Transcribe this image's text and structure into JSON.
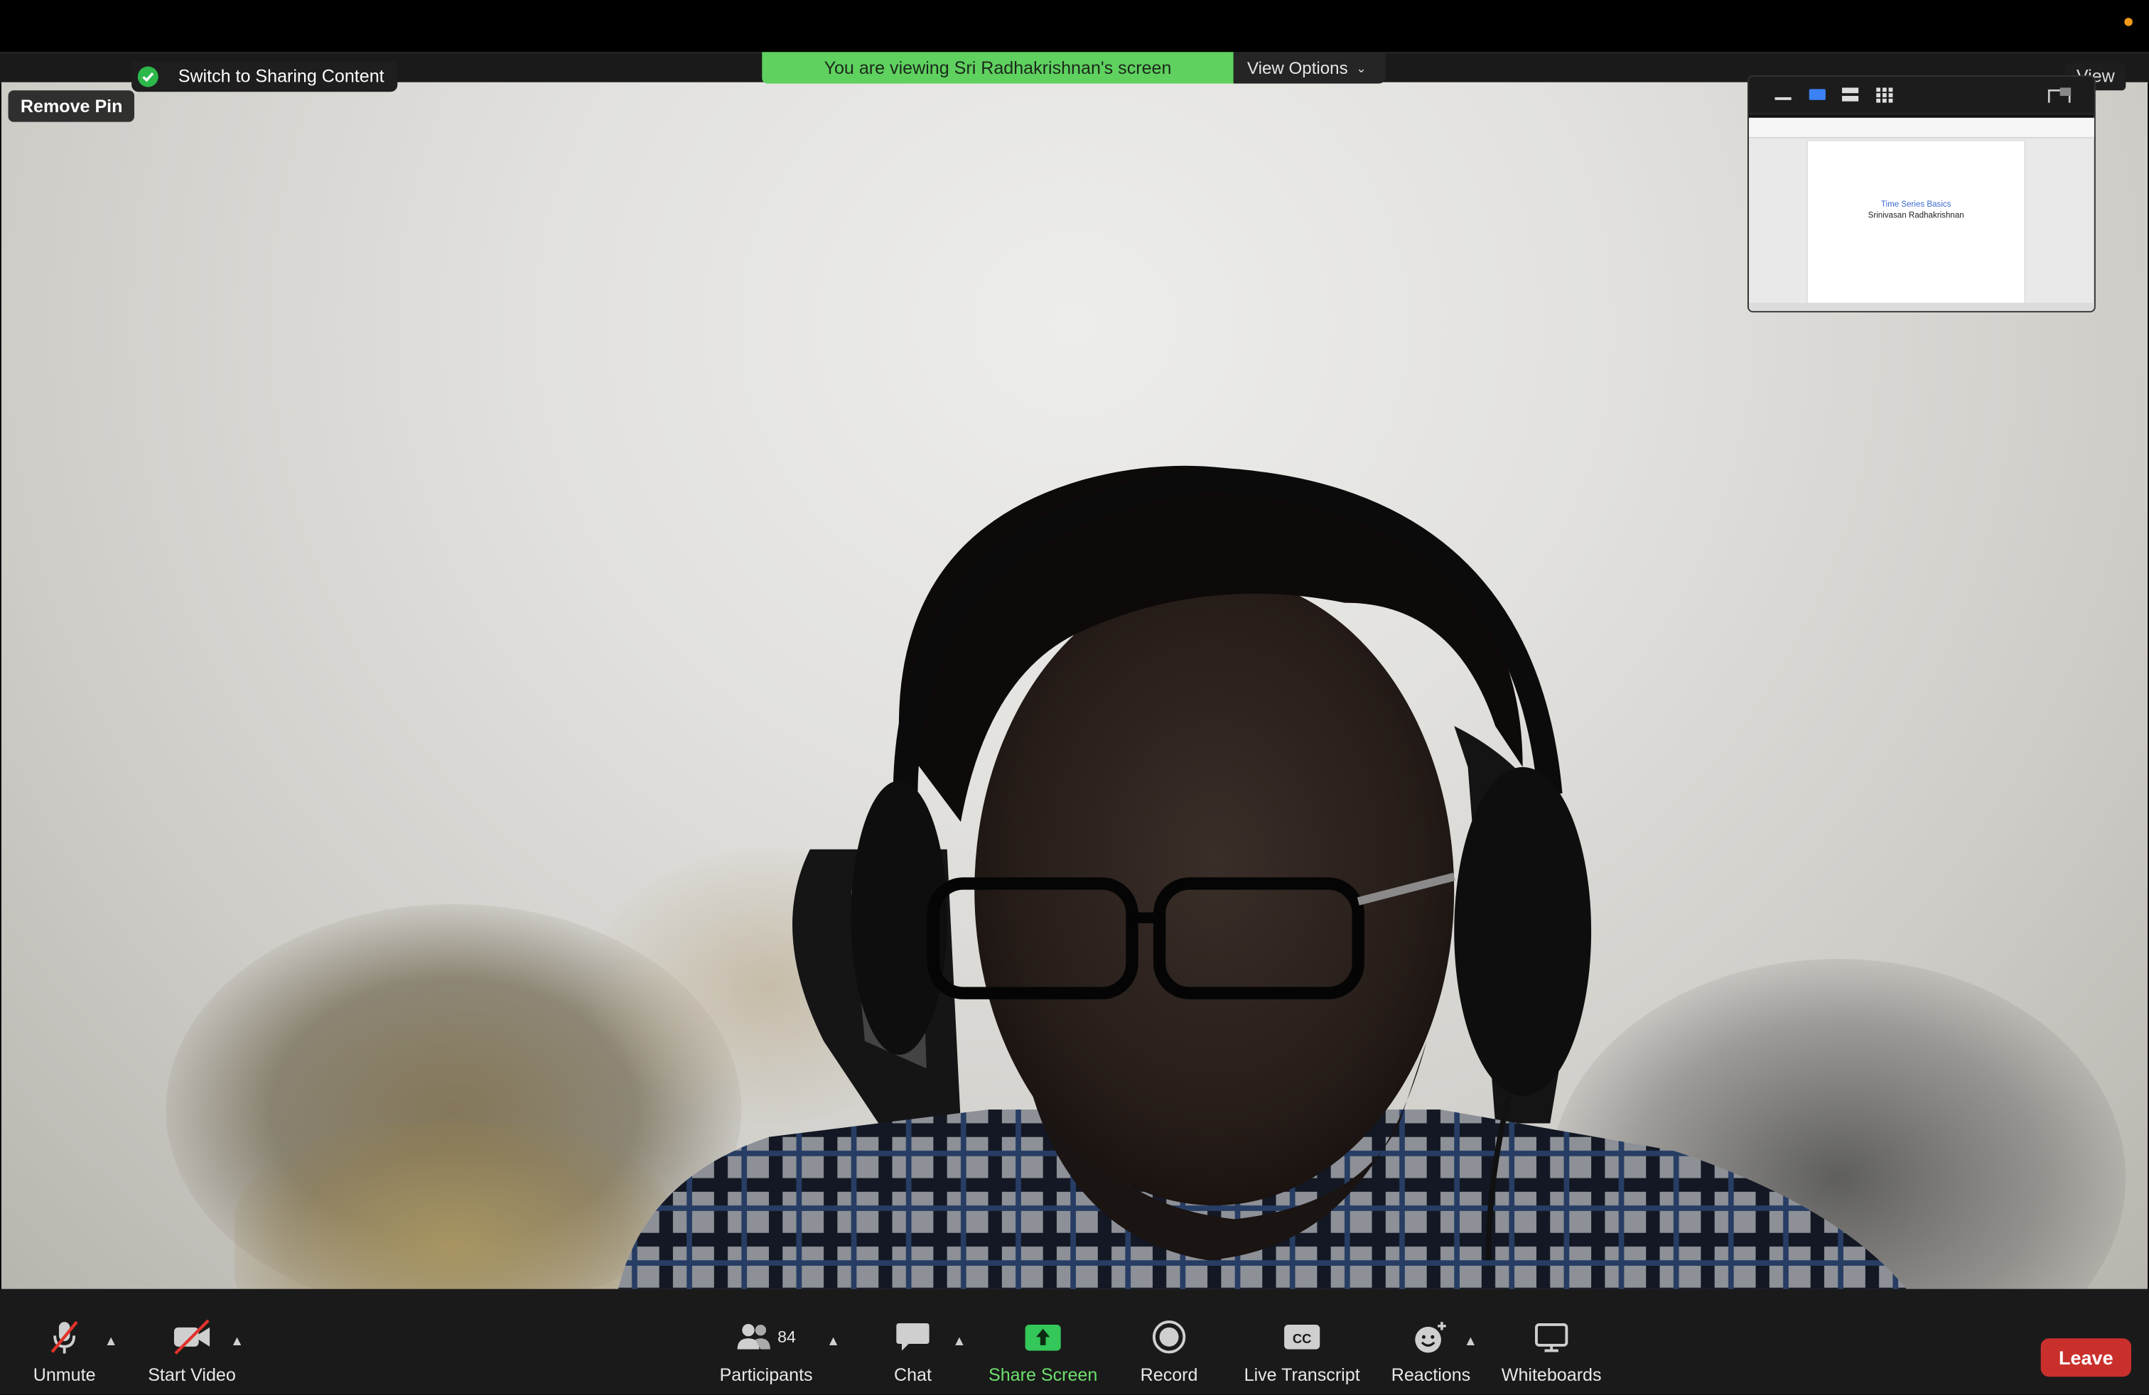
{
  "meeting": {
    "banner_text": "You are viewing Sri Radhakrishnan's screen",
    "view_options_label": "View Options",
    "view_label": "View",
    "switch_label": "Switch to Sharing Content",
    "remove_pin_label": "Remove Pin"
  },
  "thumbnail": {
    "slide_title": "Time Series Basics",
    "slide_subtitle": "Srinivasan Radhakrishnan"
  },
  "toolbar": {
    "unmute_label": "Unmute",
    "start_video_label": "Start Video",
    "participants_label": "Participants",
    "participants_count": "84",
    "chat_label": "Chat",
    "share_screen_label": "Share Screen",
    "record_label": "Record",
    "live_transcript_label": "Live Transcript",
    "cc_badge": "CC",
    "reactions_label": "Reactions",
    "whiteboards_label": "Whiteboards",
    "leave_label": "Leave"
  },
  "colors": {
    "banner_green": "#5fd15f",
    "share_green": "#6ee06e",
    "leave_red": "#c9302c",
    "toolbar_bg": "#1a1a1a"
  },
  "icons": [
    "shield-check-icon",
    "chevron-down-icon",
    "mic-muted-icon",
    "video-off-icon",
    "participants-icon",
    "chat-icon",
    "share-screen-icon",
    "record-icon",
    "cc-icon",
    "reactions-icon",
    "whiteboard-icon"
  ]
}
